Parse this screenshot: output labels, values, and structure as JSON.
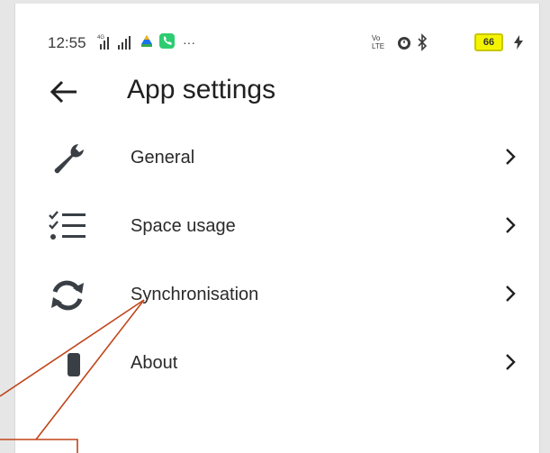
{
  "status_bar": {
    "time": "12:55",
    "battery_level": "66",
    "left_icons": [
      "signal-icon",
      "signal-icon",
      "drive-icon",
      "phone-app-icon",
      "more-icon"
    ],
    "right_icons": [
      "volte-icon",
      "alarm-icon",
      "bluetooth-icon",
      "battery-icon",
      "charging-icon"
    ]
  },
  "header": {
    "title": "App settings"
  },
  "settings": {
    "items": [
      {
        "label": "General",
        "icon": "wrench-icon"
      },
      {
        "label": "Space usage",
        "icon": "checklist-icon"
      },
      {
        "label": "Synchronisation",
        "icon": "sync-icon"
      },
      {
        "label": "About",
        "icon": "info-icon"
      }
    ]
  },
  "colors": {
    "annotation": "#c0441a",
    "battery": "#f4f400",
    "icon": "#3a3f45"
  }
}
